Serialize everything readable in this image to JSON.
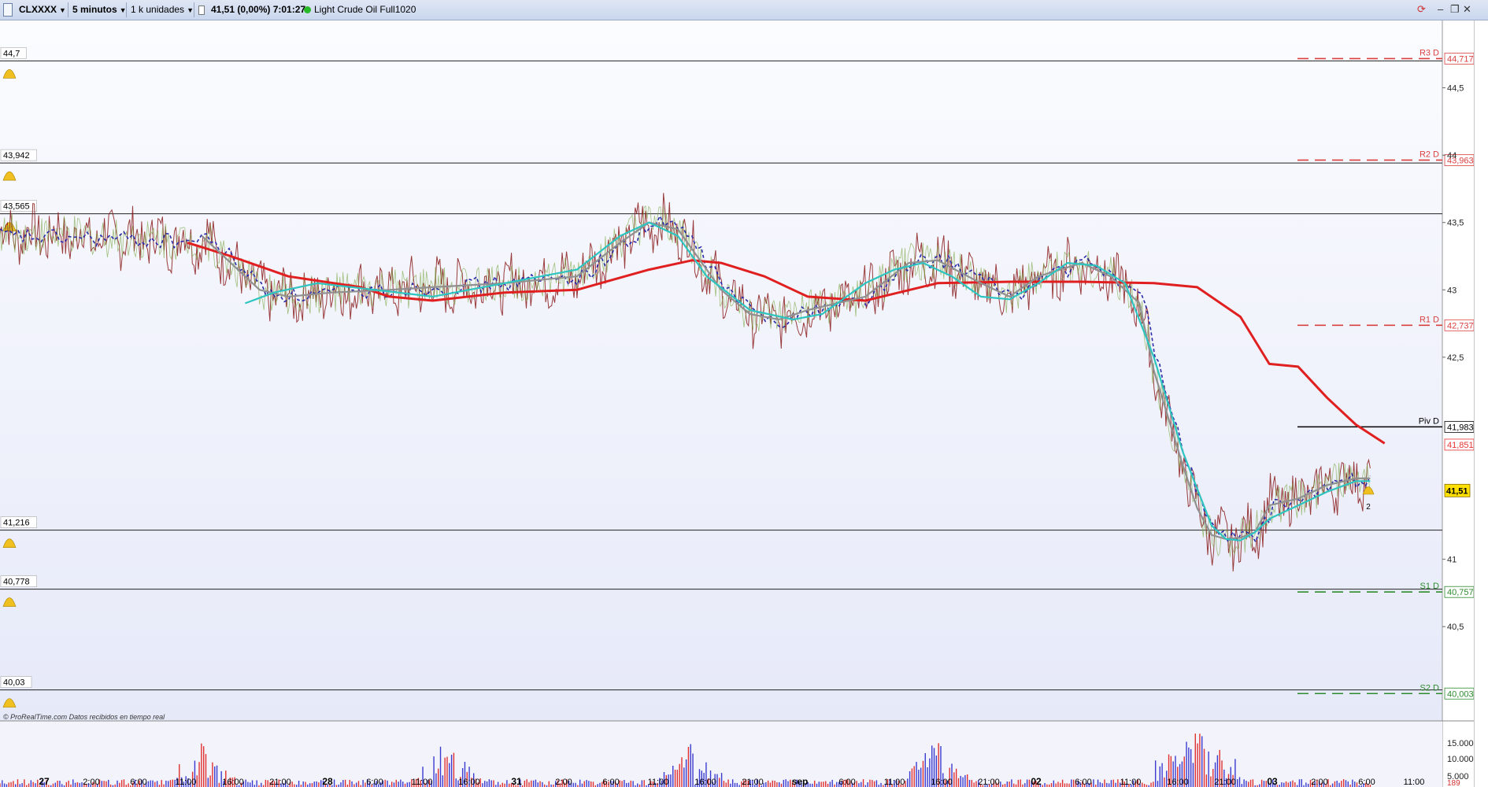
{
  "toolbar": {
    "symbol": "CLXXXX",
    "timeframe": "5 minutos",
    "units": "1 k unidades",
    "quote": "41,51 (0,00%) 7:01:27",
    "instrument": "Light Crude Oil Full1020",
    "icons": [
      "symbol-icon",
      "info-icon",
      "live-status-icon",
      "refresh-icon",
      "minimize-icon",
      "restore-icon",
      "close-icon"
    ]
  },
  "credit": "© ProRealTime.com  Datos recibidos en tiempo real",
  "chart_data": {
    "type": "line",
    "price_axis": {
      "ticks": [
        "44,5",
        "44",
        "43,5",
        "43",
        "42,5",
        "41",
        "40,5"
      ],
      "range": [
        39.8,
        45.0
      ]
    },
    "time_axis_labels": [
      "27",
      "2:00",
      "6:00",
      "11:00",
      "16:00",
      "21:00",
      "28",
      "6:00",
      "11:00",
      "16:00",
      "31",
      "2:00",
      "6:00",
      "11:00",
      "16:00",
      "21:00",
      "sep",
      "6:00",
      "11:00",
      "16:00",
      "21:00",
      "02",
      "6:00",
      "11:00",
      "16:00",
      "21:00",
      "03",
      "2:00",
      "6:00",
      "11:00"
    ],
    "horizontal_lines": [
      {
        "label": "44,7",
        "value": 44.7
      },
      {
        "label": "43,942",
        "value": 43.942
      },
      {
        "label": "43,565",
        "value": 43.565
      },
      {
        "label": "41,216",
        "value": 41.216
      },
      {
        "label": "40,778",
        "value": 40.778
      },
      {
        "label": "40,03",
        "value": 40.03
      }
    ],
    "pivots": [
      {
        "name": "R3 D",
        "value": 44.717,
        "value_label": "44,717",
        "color": "#d94040"
      },
      {
        "name": "R2 D",
        "value": 43.963,
        "value_label": "43,963",
        "color": "#d94040"
      },
      {
        "name": "R1 D",
        "value": 42.737,
        "value_label": "42,737",
        "color": "#d94040"
      },
      {
        "name": "Piv D",
        "value": 41.983,
        "value_label": "41,983",
        "color": "#000000"
      },
      {
        "name": "S1 D",
        "value": 40.757,
        "value_label": "40,757",
        "color": "#2e8b2e"
      },
      {
        "name": "S2 D",
        "value": 40.003,
        "value_label": "40,003",
        "color": "#2e8b2e"
      }
    ],
    "ma_label": {
      "value": 41.851,
      "text": "41,851",
      "color": "#e83030"
    },
    "last_price": {
      "value": 41.51,
      "text": "41,51",
      "color": "#ffe000"
    },
    "alert_count": "2",
    "series": [
      {
        "key": "red_ma",
        "color": "#e02020",
        "x": [
          0.13,
          0.16,
          0.2,
          0.25,
          0.27,
          0.3,
          0.35,
          0.4,
          0.45,
          0.48,
          0.5,
          0.53,
          0.56,
          0.6,
          0.65,
          0.7,
          0.75,
          0.8,
          0.83,
          0.86,
          0.88,
          0.9,
          0.92,
          0.94,
          0.96
        ],
        "y": [
          43.35,
          43.25,
          43.1,
          43.02,
          42.95,
          42.92,
          42.98,
          43.0,
          43.15,
          43.22,
          43.2,
          43.1,
          42.95,
          42.92,
          43.05,
          43.06,
          43.06,
          43.05,
          43.02,
          42.8,
          42.45,
          42.43,
          42.2,
          42.0,
          41.86
        ]
      },
      {
        "key": "gray_ma",
        "color": "#909090",
        "x": [
          0.14,
          0.16,
          0.18,
          0.2,
          0.23,
          0.27,
          0.3,
          0.35,
          0.4,
          0.43,
          0.45,
          0.47,
          0.5,
          0.52,
          0.54,
          0.56,
          0.6,
          0.63,
          0.65,
          0.68,
          0.7,
          0.72,
          0.75,
          0.77,
          0.79,
          0.8,
          0.82,
          0.83,
          0.84,
          0.85,
          0.86,
          0.87,
          0.875,
          0.88,
          0.9,
          0.92,
          0.94,
          0.95
        ],
        "y": [
          43.4,
          43.2,
          43.0,
          42.95,
          42.98,
          43.0,
          43.02,
          43.05,
          43.1,
          43.35,
          43.5,
          43.45,
          43.0,
          42.82,
          42.78,
          42.85,
          42.95,
          43.2,
          43.22,
          43.05,
          42.95,
          43.1,
          43.2,
          43.1,
          42.9,
          42.4,
          41.7,
          41.38,
          41.18,
          41.15,
          41.16,
          41.2,
          41.3,
          41.4,
          41.45,
          41.55,
          41.6,
          41.6
        ]
      },
      {
        "key": "cyan_ma",
        "color": "#2ec4c0",
        "x": [
          0.17,
          0.19,
          0.22,
          0.26,
          0.3,
          0.35,
          0.4,
          0.43,
          0.45,
          0.47,
          0.49,
          0.52,
          0.55,
          0.57,
          0.6,
          0.62,
          0.64,
          0.66,
          0.68,
          0.7,
          0.72,
          0.74,
          0.76,
          0.78,
          0.8,
          0.82,
          0.84,
          0.85,
          0.86,
          0.87,
          0.88,
          0.9,
          0.92,
          0.94,
          0.95
        ],
        "y": [
          42.9,
          42.98,
          43.05,
          43.0,
          42.95,
          43.05,
          43.15,
          43.4,
          43.5,
          43.4,
          43.1,
          42.85,
          42.78,
          42.82,
          43.05,
          43.15,
          43.2,
          43.1,
          42.95,
          42.93,
          43.05,
          43.2,
          43.18,
          43.05,
          42.5,
          41.8,
          41.25,
          41.15,
          41.14,
          41.2,
          41.3,
          41.4,
          41.5,
          41.58,
          41.58
        ]
      }
    ],
    "volume_axis": {
      "ticks": [
        "15.000",
        "10.000",
        "5.000"
      ],
      "last": "189"
    },
    "price_walk_seed": 7
  }
}
